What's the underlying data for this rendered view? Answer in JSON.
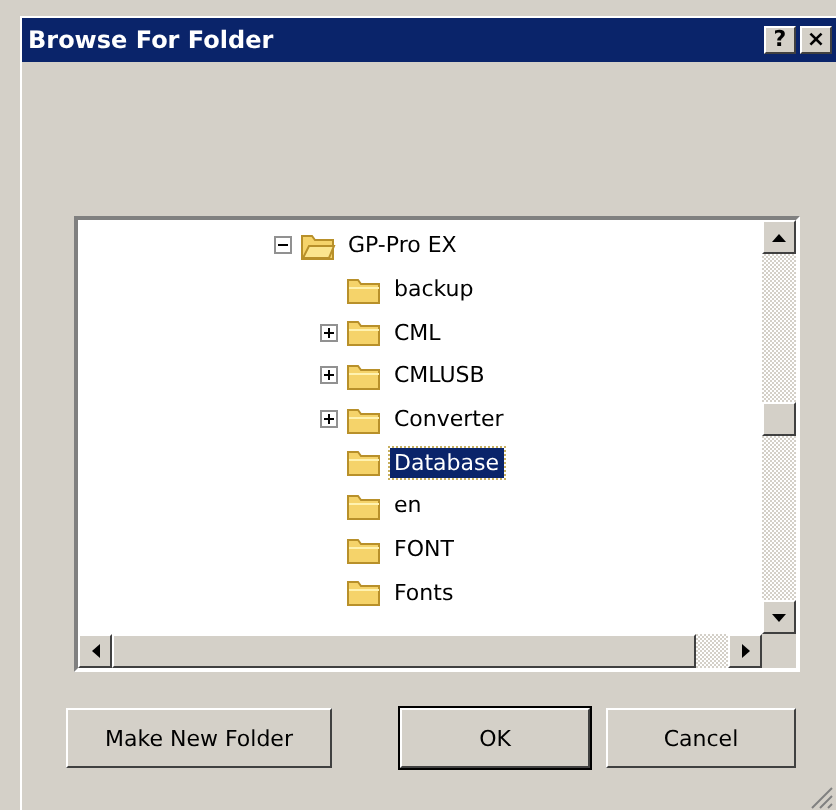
{
  "window": {
    "title": "Browse For Folder",
    "title_buttons": [
      "?",
      "×"
    ]
  },
  "tree": {
    "items": [
      {
        "label": "GP-Pro EX",
        "kind": "branch",
        "expanded": true,
        "selected": false,
        "children": [
          {
            "label": "backup",
            "kind": "leaf",
            "expanded": false,
            "selected": false
          },
          {
            "label": "CML",
            "kind": "branch",
            "expanded": false,
            "selected": false
          },
          {
            "label": "CMLUSB",
            "kind": "branch",
            "expanded": false,
            "selected": false
          },
          {
            "label": "Converter",
            "kind": "branch",
            "expanded": false,
            "selected": false
          },
          {
            "label": "Database",
            "kind": "leaf",
            "expanded": false,
            "selected": true
          },
          {
            "label": "en",
            "kind": "leaf",
            "expanded": false,
            "selected": false
          },
          {
            "label": "FONT",
            "kind": "leaf",
            "expanded": false,
            "selected": false
          },
          {
            "label": "Fonts",
            "kind": "leaf",
            "expanded": false,
            "selected": false
          }
        ]
      }
    ]
  },
  "buttons": [
    {
      "label": "Make New Folder",
      "default": false
    },
    {
      "label": "OK",
      "default": true
    },
    {
      "label": "Cancel",
      "default": false
    }
  ]
}
